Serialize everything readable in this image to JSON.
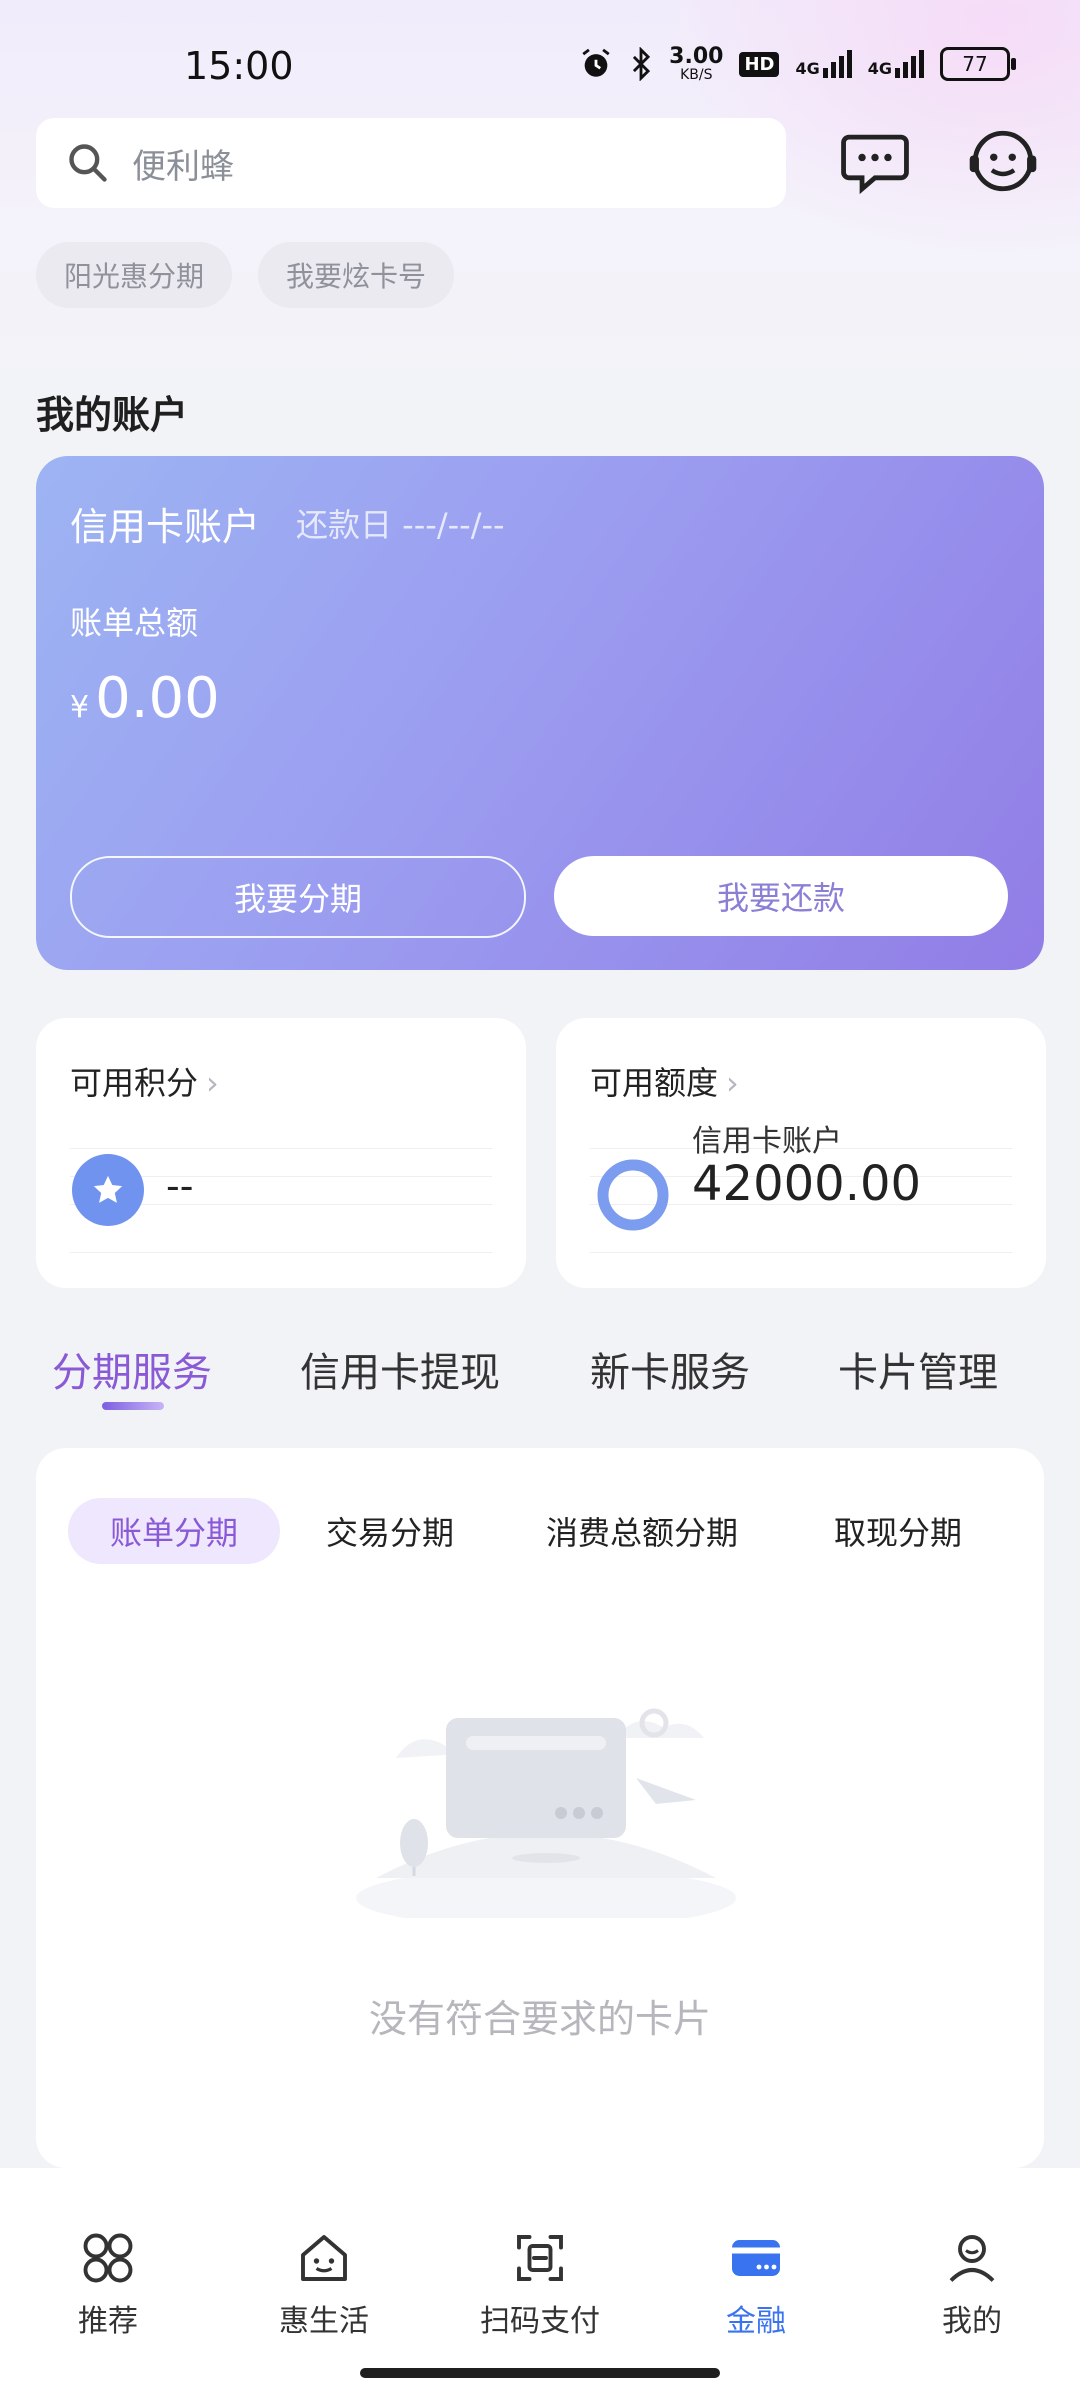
{
  "status_bar": {
    "time": "15:00",
    "speed": "3.00",
    "speed_unit": "KB/S",
    "network1": "4G",
    "network2": "4G",
    "hd": "HD",
    "battery": "77"
  },
  "search": {
    "placeholder": "便利蜂"
  },
  "chips": [
    "阳光惠分期",
    "我要炫卡号"
  ],
  "section_title": "我的账户",
  "account": {
    "title": "信用卡账户",
    "due": "还款日 ---/--/--",
    "bill_label": "账单总额",
    "currency": "¥",
    "amount": "0.00",
    "installment_button": "我要分期",
    "repay_button": "我要还款"
  },
  "points": {
    "label": "可用积分",
    "value": "--"
  },
  "credit": {
    "label": "可用额度",
    "sub_label": "信用卡账户",
    "value": "42000.00"
  },
  "service_tabs": [
    "分期服务",
    "信用卡提现",
    "新卡服务",
    "卡片管理"
  ],
  "sub_tabs": [
    "账单分期",
    "交易分期",
    "消费总额分期",
    "取现分期"
  ],
  "empty_text": "没有符合要求的卡片",
  "bottom_nav": [
    {
      "label": "推荐",
      "icon": "grid-icon"
    },
    {
      "label": "惠生活",
      "icon": "house-icon"
    },
    {
      "label": "扫码支付",
      "icon": "scan-icon"
    },
    {
      "label": "金融",
      "icon": "card-icon"
    },
    {
      "label": "我的",
      "icon": "user-icon"
    }
  ],
  "colors": {
    "accent_purple": "#8a5ad6",
    "nav_active": "#3a73f0",
    "card_start": "#9db4f3",
    "card_end": "#917de6"
  }
}
